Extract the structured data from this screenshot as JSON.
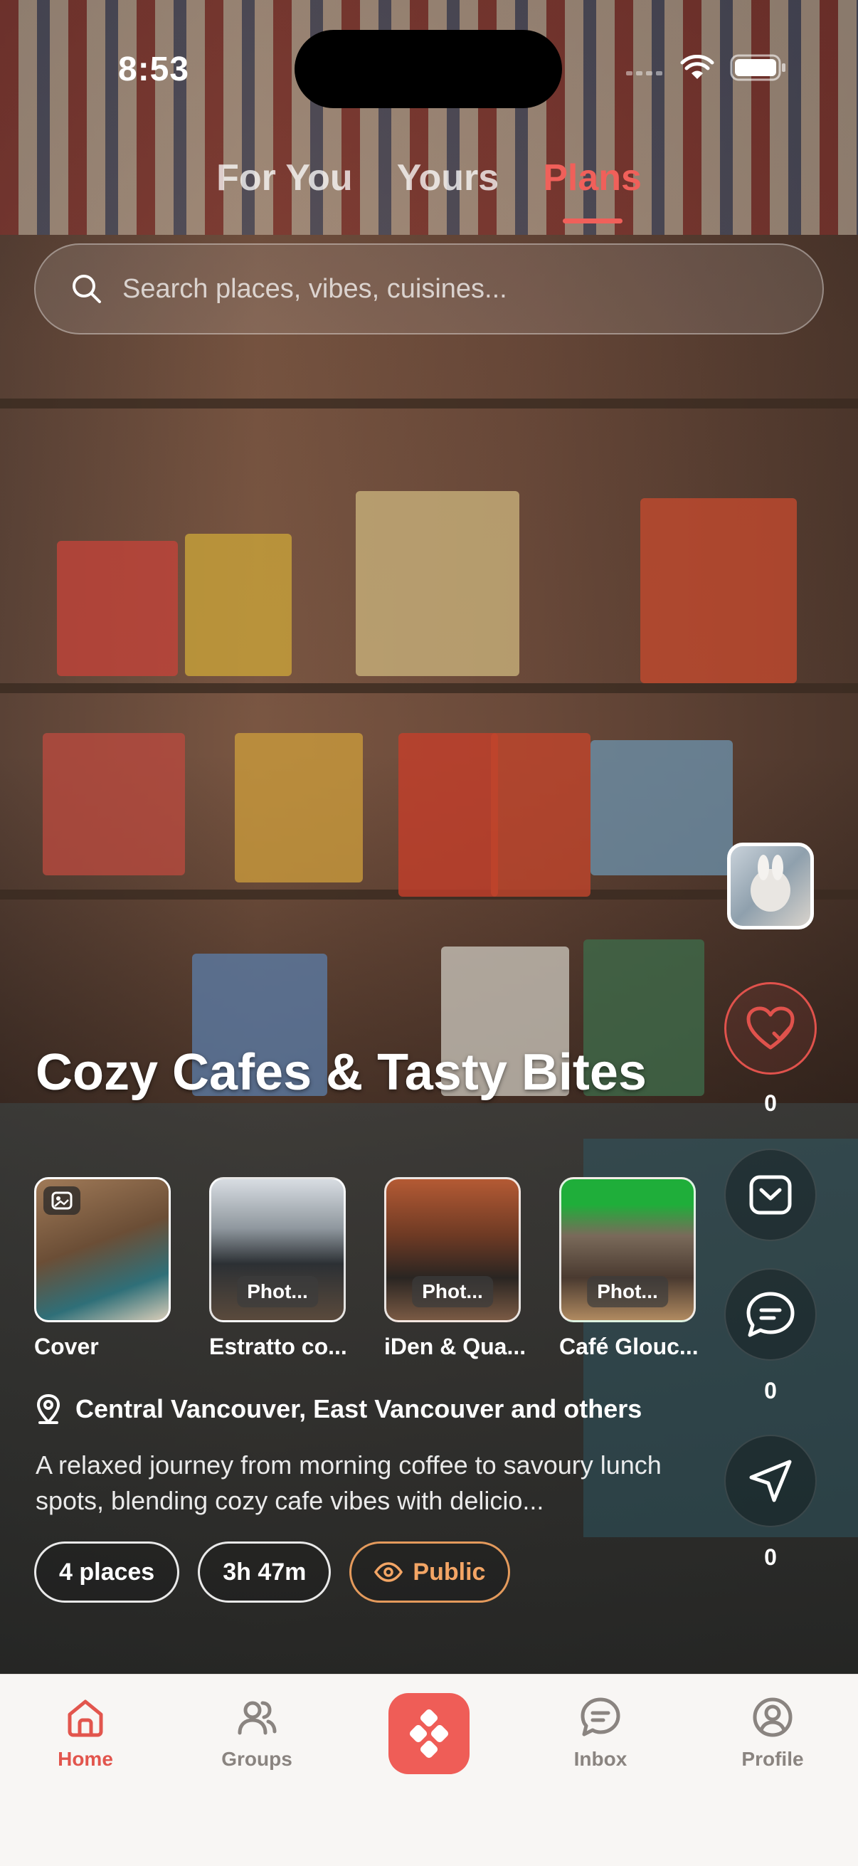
{
  "status_bar": {
    "time": "8:53"
  },
  "tabs": [
    {
      "label": "For You",
      "active": false
    },
    {
      "label": "Yours",
      "active": false
    },
    {
      "label": "Plans",
      "active": true
    }
  ],
  "search": {
    "placeholder": "Search places, vibes, cuisines..."
  },
  "plan": {
    "title": "Cozy Cafes & Tasty Bites",
    "places": [
      {
        "label": "Cover",
        "badge": ""
      },
      {
        "label": "Estratto co...",
        "badge": "Phot..."
      },
      {
        "label": "iDen & Qua...",
        "badge": "Phot..."
      },
      {
        "label": "Café Glouc...",
        "badge": "Phot..."
      }
    ],
    "location": "Central Vancouver, East Vancouver and others",
    "description": "A relaxed journey from morning coffee to savoury lunch spots, blending cozy cafe vibes with delicio...",
    "chips": {
      "places": "4 places",
      "duration": "3h 47m",
      "visibility": "Public"
    }
  },
  "actions": {
    "likes": "0",
    "comments": "0",
    "shares": "0"
  },
  "bottom_nav": {
    "home": "Home",
    "groups": "Groups",
    "inbox": "Inbox",
    "profile": "Profile",
    "active": "home"
  },
  "colors": {
    "accent": "#ef5d57",
    "public_chip": "#f3a565",
    "nav_bg": "#f8f6f4"
  }
}
